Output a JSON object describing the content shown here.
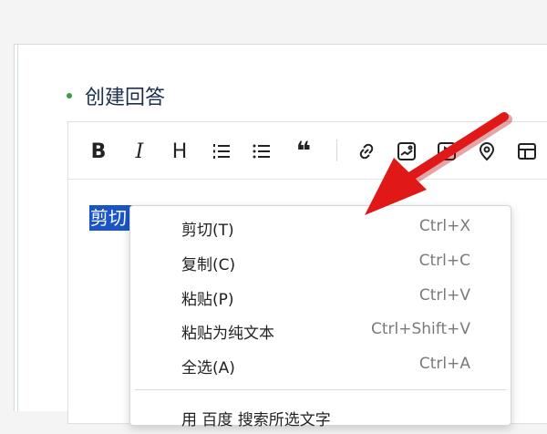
{
  "page": {
    "heading": "创建回答"
  },
  "toolbar": {
    "items": [
      {
        "name": "bold-icon",
        "glyph": "B"
      },
      {
        "name": "italic-icon",
        "glyph": "I"
      },
      {
        "name": "heading-icon",
        "glyph": "H"
      },
      {
        "name": "ordered-list-icon"
      },
      {
        "name": "unordered-list-icon"
      },
      {
        "name": "quote-icon",
        "glyph": "❝"
      },
      {
        "name": "link-icon"
      },
      {
        "name": "image-icon"
      },
      {
        "name": "video-icon"
      },
      {
        "name": "location-icon"
      },
      {
        "name": "table-icon"
      }
    ]
  },
  "editor": {
    "selected_text": "剪切"
  },
  "context_menu": {
    "items": [
      {
        "label": "剪切(T)",
        "shortcut": "Ctrl+X"
      },
      {
        "label": "复制(C)",
        "shortcut": "Ctrl+C"
      },
      {
        "label": "粘贴(P)",
        "shortcut": "Ctrl+V"
      },
      {
        "label": "粘贴为纯文本",
        "shortcut": "Ctrl+Shift+V"
      },
      {
        "label": "全选(A)",
        "shortcut": "Ctrl+A"
      }
    ],
    "cut_off_item": "用 百度 搜索所选文字"
  },
  "colors": {
    "accent_green": "#3f9a48",
    "selection_blue": "#1a55c8",
    "arrow_red": "#e01818"
  }
}
